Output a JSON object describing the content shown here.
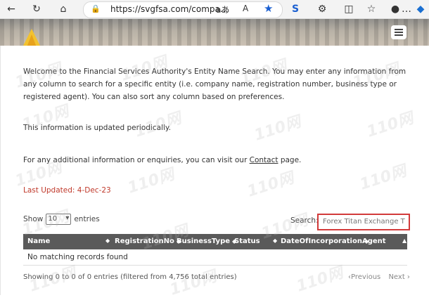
{
  "browser": {
    "url": "https://svgfsa.com/compa...",
    "icons": [
      "back-icon",
      "refresh-icon",
      "home-icon",
      "lock-icon",
      "read-aloud-icon",
      "text-size-icon",
      "favorite-star-icon",
      "extension-s-icon",
      "extensions-icon",
      "split-screen-icon",
      "favorites-icon",
      "profile-icon",
      "more-icon",
      "copilot-icon"
    ]
  },
  "intro": {
    "paragraph1": "Welcome to the Financial Services Authority's Entity Name Search. You may enter any information from any column to search for a specific entity (i.e. company name, registration number, business type or registered agent). You can also sort any column based on preferences.",
    "paragraph2": "This information is updated periodically.",
    "paragraph3_prefix": "For any additional information or enquiries, you can visit our ",
    "paragraph3_link": "Contact",
    "paragraph3_suffix": " page.",
    "last_updated": "Last Updated:  4-Dec-23"
  },
  "table_controls": {
    "show_label": "Show",
    "entries_value": "10",
    "entries_label": "entries",
    "search_label": "Search:",
    "search_value": "Forex Titan Exchange T"
  },
  "table": {
    "columns": [
      "Name",
      "RegistrationNo",
      "BusinessType",
      "Status",
      "DateOfIncorporation",
      "Agent"
    ],
    "empty_message": "No matching records found",
    "info": "Showing 0 to 0 of 0 entries (filtered from 4,756 total entries)",
    "previous": "Previous",
    "next": "Next"
  },
  "watermark": "110网",
  "colors": {
    "red": "#c0392b",
    "header": "#5a5a5a",
    "search_border": "#d23a3a"
  }
}
